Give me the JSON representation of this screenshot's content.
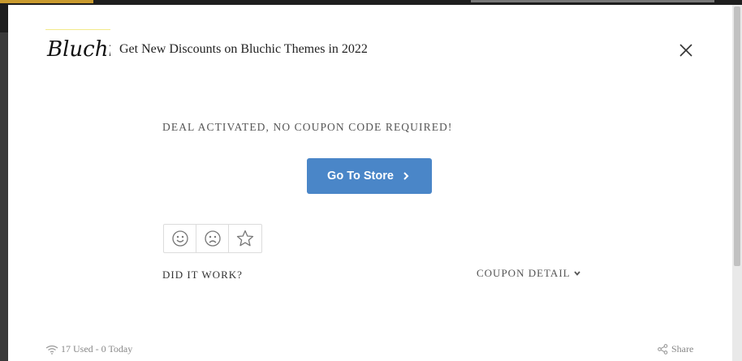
{
  "header": {
    "logo_text": "Bluchic",
    "title": "Get New Discounts on Bluchic Themes in 2022"
  },
  "deal": {
    "message": "DEAL ACTIVATED, NO COUPON CODE REQUIRED!",
    "store_button_label": "Go To Store"
  },
  "feedback": {
    "question": "DID IT WORK?",
    "icons": [
      "smile-icon",
      "sad-icon",
      "star-icon"
    ]
  },
  "coupon_detail_label": "COUPON DETAIL",
  "footer": {
    "usage": "17 Used - 0 Today",
    "share_label": "Share"
  },
  "colors": {
    "button": "#4a86c8",
    "modal_bg": "#ffffff",
    "text": "#555555"
  }
}
